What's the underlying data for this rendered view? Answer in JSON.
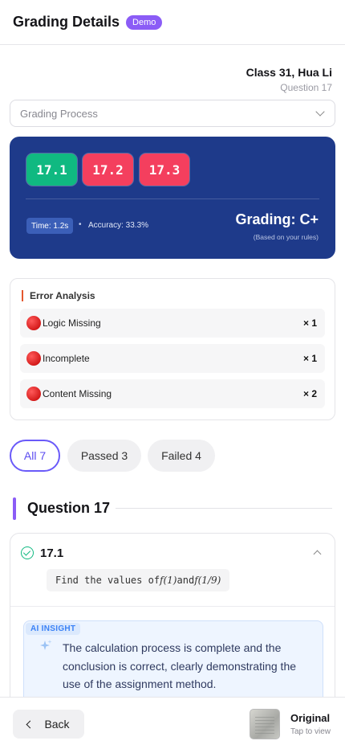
{
  "header": {
    "title": "Grading Details",
    "badge": "Demo"
  },
  "student": {
    "name": "Class 31, Hua Li",
    "question": "Question 17"
  },
  "process_select": {
    "value": "Grading Process"
  },
  "summary": {
    "chips": [
      {
        "label": "17.1",
        "status": "pass"
      },
      {
        "label": "17.2",
        "status": "fail"
      },
      {
        "label": "17.3",
        "status": "fail"
      }
    ],
    "time": "Time: 1.2s",
    "separator": "•",
    "accuracy": "Accuracy: 33.3%",
    "grade": "Grading: C+",
    "grade_note": "(Based on your rules)"
  },
  "error_analysis": {
    "title": "Error Analysis",
    "items": [
      {
        "label": "Logic Missing",
        "count": "× 1"
      },
      {
        "label": "Incomplete",
        "count": "× 1"
      },
      {
        "label": "Content Missing",
        "count": "× 2"
      }
    ]
  },
  "filters": {
    "all": "All 7",
    "passed": "Passed 3",
    "failed": "Failed 4"
  },
  "question": {
    "title": "Question 17",
    "sub": {
      "id": "17.1",
      "prompt_prefix": "Find the values of ",
      "f1": "f(1)",
      "and": " and ",
      "f2": "f(1/9)",
      "insight_label": "AI INSIGHT",
      "insight_text": "The calculation process is complete and the conclusion is correct, clearly demonstrating the use of the assignment method."
    }
  },
  "footer": {
    "back": "Back",
    "original_title": "Original",
    "original_sub": "Tap to view"
  },
  "colors": {
    "accent": "#8b5cf6",
    "hero": "#1e3a8a",
    "pass": "#10b981",
    "fail": "#f43f5e"
  }
}
